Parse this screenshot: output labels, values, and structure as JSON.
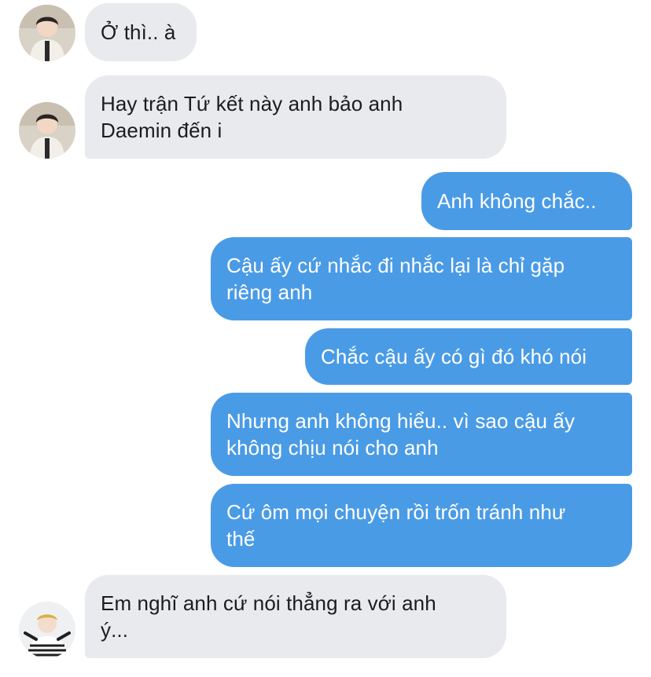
{
  "chat": {
    "messages": [
      {
        "sender": "contact",
        "text": "Ở thì.. à"
      },
      {
        "sender": "contact",
        "text": "Hay trận Tứ kết này anh bảo anh\nDaemin đến i"
      },
      {
        "sender": "me",
        "text": "Anh không chắc.."
      },
      {
        "sender": "me",
        "text": "Cậu ấy cứ nhắc đi nhắc lại là chỉ gặp\nriêng anh"
      },
      {
        "sender": "me",
        "text": "Chắc cậu ấy có gì đó khó nói"
      },
      {
        "sender": "me",
        "text": "Nhưng anh không hiểu.. vì sao cậu ấy\nkhông chịu nói cho anh"
      },
      {
        "sender": "me",
        "text": "Cứ ôm mọi chuyện rồi trốn tránh như\nthế"
      },
      {
        "sender": "contact2",
        "text": "Em nghĩ anh cứ nói thẳng ra với anh\ný..."
      }
    ]
  },
  "colors": {
    "incoming_bubble": "#e9eaee",
    "outgoing_bubble": "#4a9be6",
    "incoming_text": "#1c1c1e",
    "outgoing_text": "#ffffff"
  },
  "icons": {
    "avatar_contact": "person-photo-avatar",
    "avatar_contact2": "person-photo-avatar"
  }
}
